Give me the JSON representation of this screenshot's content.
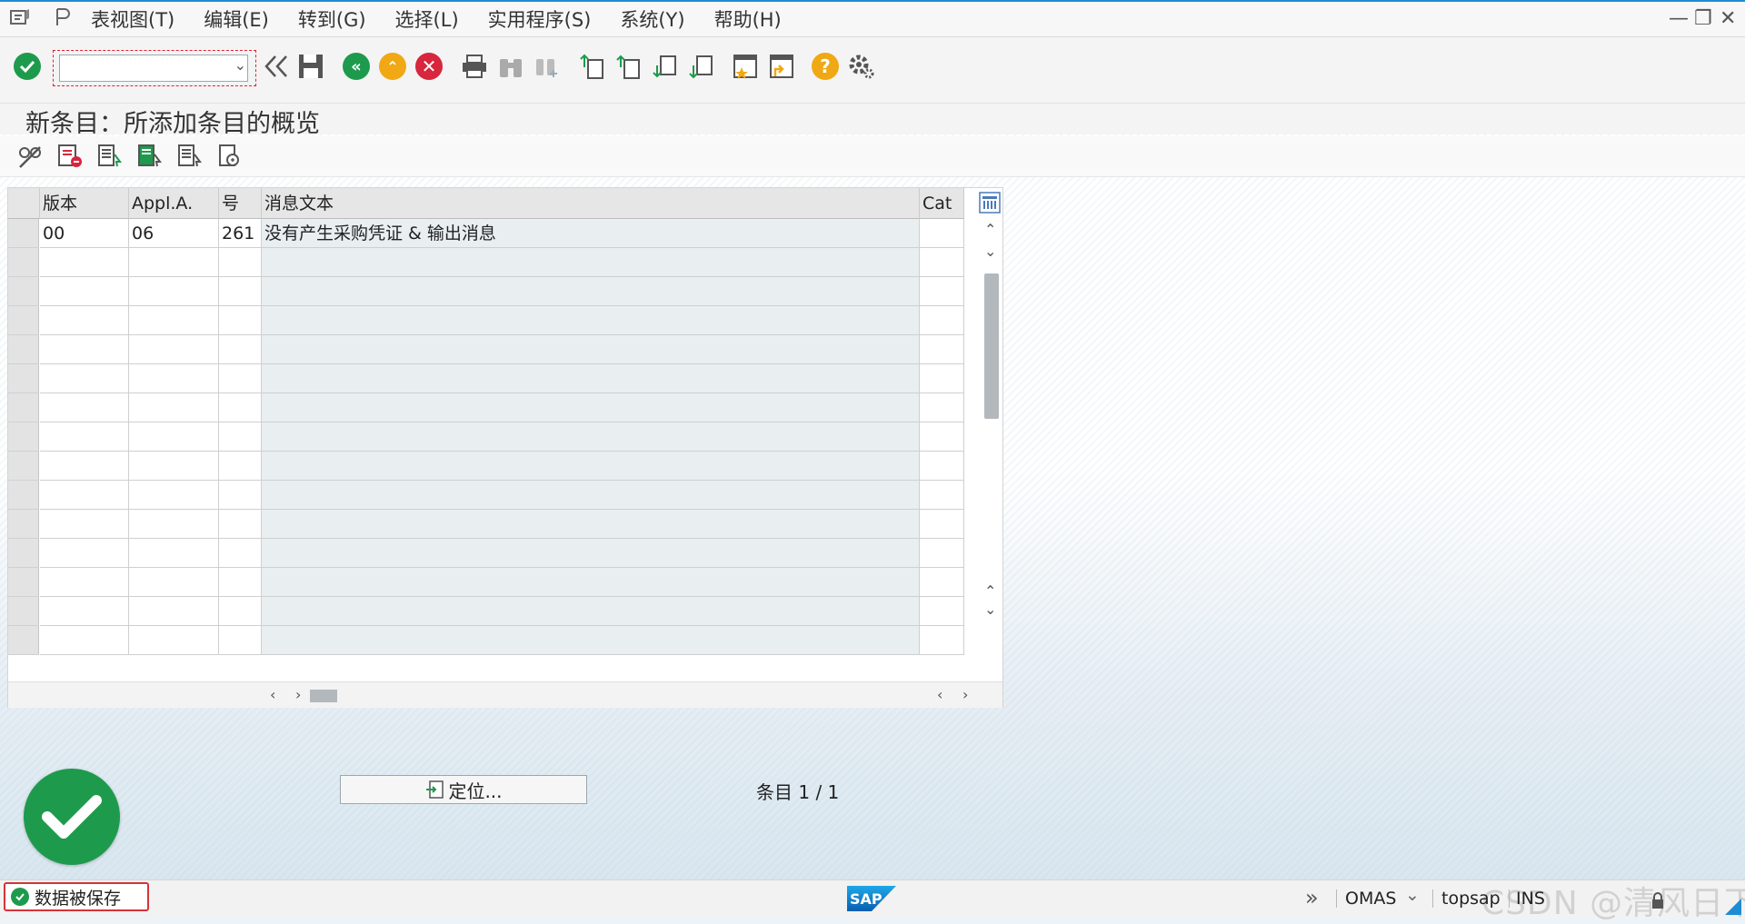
{
  "menu": {
    "items": [
      "表视图(T)",
      "编辑(E)",
      "转到(G)",
      "选择(L)",
      "实用程序(S)",
      "系统(Y)",
      "帮助(H)"
    ]
  },
  "window_controls": {
    "minimize": "—",
    "restore": "❐",
    "close": "✕"
  },
  "toolbar": {
    "command_field_value": "",
    "icons": [
      "enter-icon",
      "back-double-arrow-icon",
      "save-icon",
      "back-icon",
      "exit-icon",
      "cancel-icon",
      "print-icon",
      "find-icon",
      "find-next-icon",
      "first-page-icon",
      "previous-page-icon",
      "next-page-icon",
      "last-page-icon",
      "create-session-icon",
      "shortcut-icon",
      "help-icon",
      "settings-icon"
    ]
  },
  "page": {
    "title": "新条目：所添加条目的概览"
  },
  "app_toolbar": {
    "icons": [
      "change-display-icon",
      "delete-icon",
      "select-all-icon",
      "select-block-icon",
      "deselect-all-icon",
      "details-icon"
    ]
  },
  "table": {
    "columns": [
      "版本",
      "Appl.A.",
      "号",
      "消息文本",
      "Cat"
    ],
    "rows": [
      {
        "version": "00",
        "appl": "06",
        "number": "261",
        "message": "没有产生采购凭证 & 输出消息",
        "cat": ""
      }
    ],
    "empty_rows": 15
  },
  "bottom": {
    "locate_button": "定位...",
    "entry_count": "条目 1 / 1"
  },
  "status_bar": {
    "message": "数据被保存",
    "system": "OMAS",
    "server": "topsap",
    "mode": "INS",
    "watermark": "CSDN @清风日下"
  },
  "colors": {
    "accent": "#1e8dd2",
    "success": "#1e9a4c",
    "error_border": "#d3343a"
  }
}
